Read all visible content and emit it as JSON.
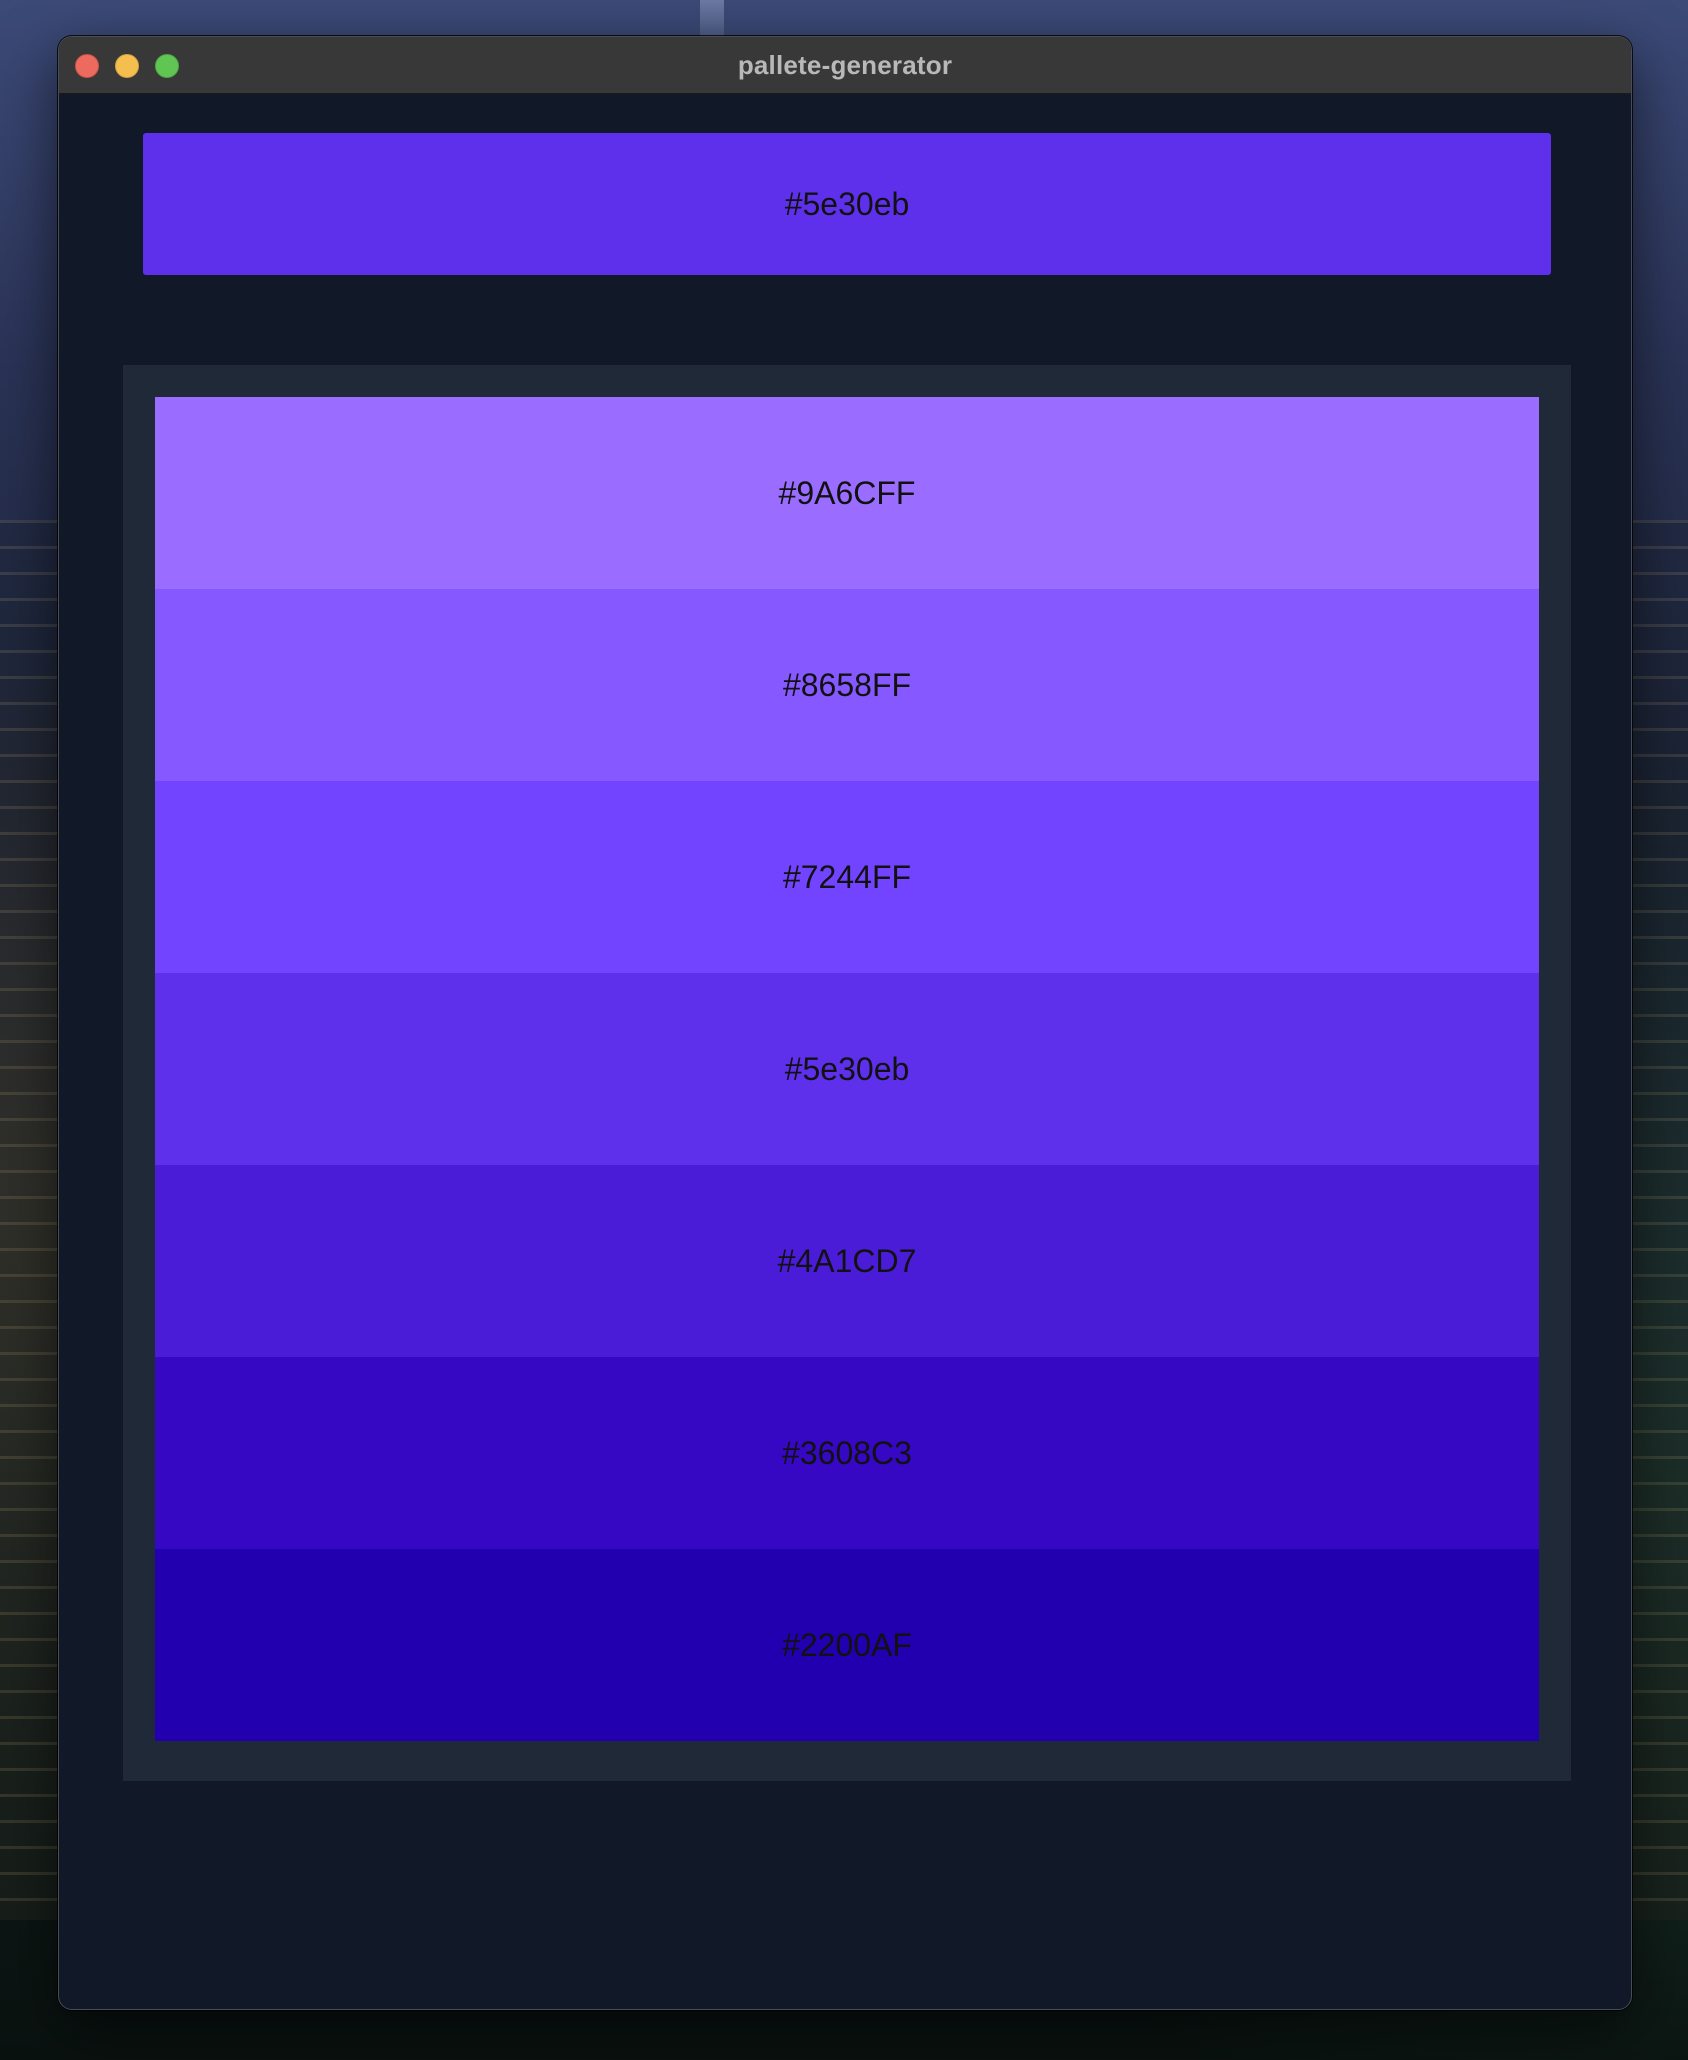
{
  "window": {
    "title": "pallete-generator"
  },
  "primary": {
    "label": "#5e30eb",
    "color": "#5e30eb"
  },
  "palette": [
    {
      "label": "#9A6CFF",
      "color": "#9A6CFF"
    },
    {
      "label": "#8658FF",
      "color": "#8658FF"
    },
    {
      "label": "#7244FF",
      "color": "#7244FF"
    },
    {
      "label": "#5e30eb",
      "color": "#5e30eb"
    },
    {
      "label": "#4A1CD7",
      "color": "#4A1CD7"
    },
    {
      "label": "#3608C3",
      "color": "#3608C3"
    },
    {
      "label": "#2200AF",
      "color": "#2200AF"
    }
  ]
}
